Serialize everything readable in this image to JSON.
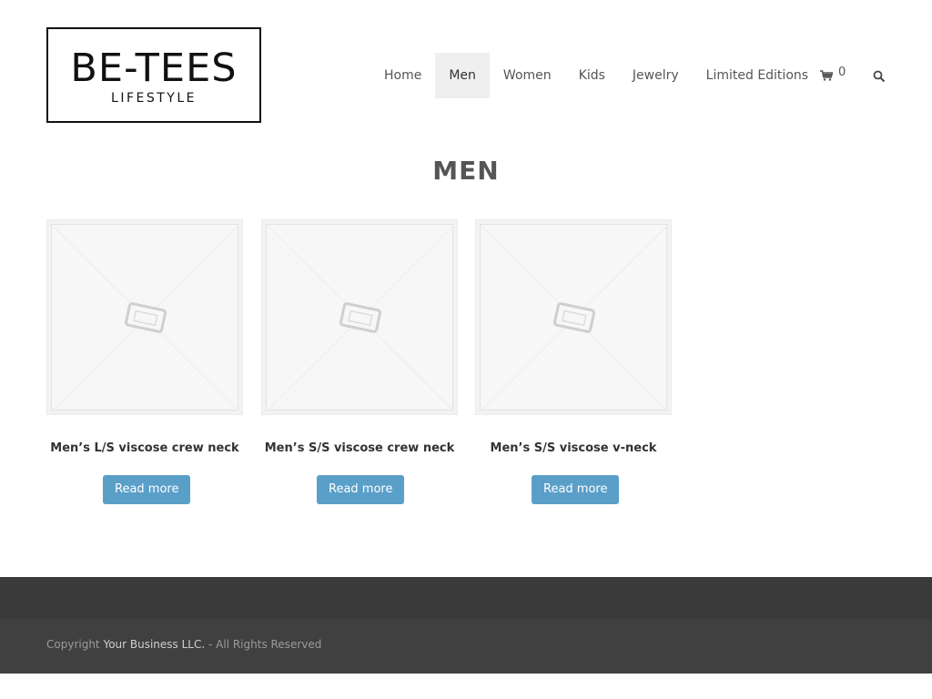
{
  "logo": {
    "title": "BE-TEES",
    "subtitle": "LIFESTYLE"
  },
  "nav": {
    "items": [
      {
        "label": "Home"
      },
      {
        "label": "Men"
      },
      {
        "label": "Women"
      },
      {
        "label": "Kids"
      },
      {
        "label": "Jewelry"
      },
      {
        "label": "Limited Editions"
      }
    ],
    "active": "Men",
    "cart_count": "0",
    "cart_icon": "cart-icon",
    "search_icon": "search-icon"
  },
  "page": {
    "title": "MEN"
  },
  "products": [
    {
      "name": "Men’s L/S viscose crew neck",
      "button": "Read more",
      "image": "placeholder-image"
    },
    {
      "name": "Men’s S/S viscose crew neck",
      "button": "Read more",
      "image": "placeholder-image"
    },
    {
      "name": "Men’s S/S viscose v-neck",
      "button": "Read more",
      "image": "placeholder-image"
    }
  ],
  "footer": {
    "copyright_prefix": "Copyright ",
    "business": "Your Business LLC.",
    "copyright_suffix": " - All Rights Reserved"
  },
  "colors": {
    "accent": "#5a9fc8",
    "footer_dark": "#3a3a3a",
    "footer": "#404040",
    "nav_active_bg": "#efefef"
  }
}
